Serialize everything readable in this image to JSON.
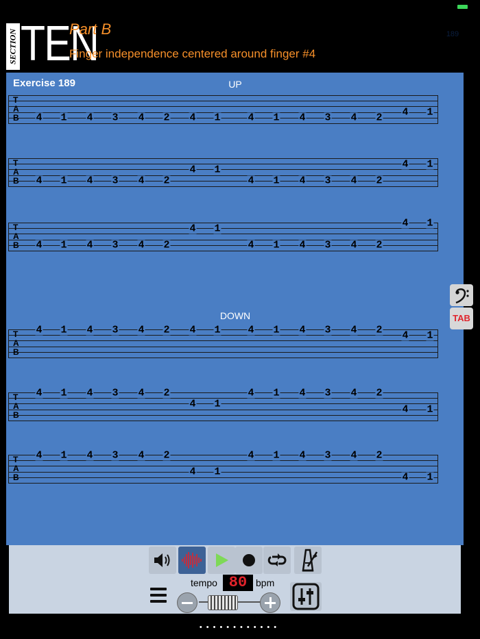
{
  "status": {
    "page_number": "189"
  },
  "header": {
    "section_word": "SECTION",
    "section_number": "TEN",
    "part_title": "Part B",
    "subtitle": "Finger independence centered around finger #4"
  },
  "exercise": {
    "title": "Exercise 189",
    "up_label": "UP",
    "down_label": "DOWN",
    "tab_letters": [
      "T",
      "A",
      "B"
    ],
    "staves": [
      {
        "frets": [
          {
            "s": 4,
            "v": "4"
          },
          {
            "s": 4,
            "v": "1"
          },
          {
            "s": 4,
            "v": "4"
          },
          {
            "s": 4,
            "v": "3"
          },
          {
            "s": 4,
            "v": "4"
          },
          {
            "s": 4,
            "v": "2"
          },
          {
            "s": 4,
            "v": "4"
          },
          {
            "s": 4,
            "v": "1"
          },
          {
            "s": 4,
            "v": "4"
          },
          {
            "s": 4,
            "v": "1"
          },
          {
            "s": 4,
            "v": "4"
          },
          {
            "s": 4,
            "v": "3"
          },
          {
            "s": 4,
            "v": "4"
          },
          {
            "s": 4,
            "v": "2"
          },
          {
            "s": 3,
            "v": "4"
          },
          {
            "s": 3,
            "v": "1"
          }
        ]
      },
      {
        "frets": [
          {
            "s": 4,
            "v": "4"
          },
          {
            "s": 4,
            "v": "1"
          },
          {
            "s": 4,
            "v": "4"
          },
          {
            "s": 4,
            "v": "3"
          },
          {
            "s": 4,
            "v": "4"
          },
          {
            "s": 4,
            "v": "2"
          },
          {
            "s": 2,
            "v": "4"
          },
          {
            "s": 2,
            "v": "1"
          },
          {
            "s": 4,
            "v": "4"
          },
          {
            "s": 4,
            "v": "1"
          },
          {
            "s": 4,
            "v": "4"
          },
          {
            "s": 4,
            "v": "3"
          },
          {
            "s": 4,
            "v": "4"
          },
          {
            "s": 4,
            "v": "2"
          },
          {
            "s": 1,
            "v": "4"
          },
          {
            "s": 1,
            "v": "1"
          }
        ]
      },
      {
        "frets": [
          {
            "s": 4,
            "v": "4"
          },
          {
            "s": 4,
            "v": "1"
          },
          {
            "s": 4,
            "v": "4"
          },
          {
            "s": 4,
            "v": "3"
          },
          {
            "s": 4,
            "v": "4"
          },
          {
            "s": 4,
            "v": "2"
          },
          {
            "s": 1,
            "v": "4"
          },
          {
            "s": 1,
            "v": "1"
          },
          {
            "s": 4,
            "v": "4"
          },
          {
            "s": 4,
            "v": "1"
          },
          {
            "s": 4,
            "v": "4"
          },
          {
            "s": 4,
            "v": "3"
          },
          {
            "s": 4,
            "v": "4"
          },
          {
            "s": 4,
            "v": "2"
          },
          {
            "s": 0,
            "v": "4"
          },
          {
            "s": 0,
            "v": "1"
          }
        ]
      },
      {
        "frets": [
          {
            "s": 0,
            "v": "4"
          },
          {
            "s": 0,
            "v": "1"
          },
          {
            "s": 0,
            "v": "4"
          },
          {
            "s": 0,
            "v": "3"
          },
          {
            "s": 0,
            "v": "4"
          },
          {
            "s": 0,
            "v": "2"
          },
          {
            "s": 0,
            "v": "4"
          },
          {
            "s": 0,
            "v": "1"
          },
          {
            "s": 0,
            "v": "4"
          },
          {
            "s": 0,
            "v": "1"
          },
          {
            "s": 0,
            "v": "4"
          },
          {
            "s": 0,
            "v": "3"
          },
          {
            "s": 0,
            "v": "4"
          },
          {
            "s": 0,
            "v": "2"
          },
          {
            "s": 1,
            "v": "4"
          },
          {
            "s": 1,
            "v": "1"
          }
        ]
      },
      {
        "frets": [
          {
            "s": 0,
            "v": "4"
          },
          {
            "s": 0,
            "v": "1"
          },
          {
            "s": 0,
            "v": "4"
          },
          {
            "s": 0,
            "v": "3"
          },
          {
            "s": 0,
            "v": "4"
          },
          {
            "s": 0,
            "v": "2"
          },
          {
            "s": 2,
            "v": "4"
          },
          {
            "s": 2,
            "v": "1"
          },
          {
            "s": 0,
            "v": "4"
          },
          {
            "s": 0,
            "v": "1"
          },
          {
            "s": 0,
            "v": "4"
          },
          {
            "s": 0,
            "v": "3"
          },
          {
            "s": 0,
            "v": "4"
          },
          {
            "s": 0,
            "v": "2"
          },
          {
            "s": 3,
            "v": "4"
          },
          {
            "s": 3,
            "v": "1"
          }
        ]
      },
      {
        "frets": [
          {
            "s": 0,
            "v": "4"
          },
          {
            "s": 0,
            "v": "1"
          },
          {
            "s": 0,
            "v": "4"
          },
          {
            "s": 0,
            "v": "3"
          },
          {
            "s": 0,
            "v": "4"
          },
          {
            "s": 0,
            "v": "2"
          },
          {
            "s": 3,
            "v": "4"
          },
          {
            "s": 3,
            "v": "1"
          },
          {
            "s": 0,
            "v": "4"
          },
          {
            "s": 0,
            "v": "1"
          },
          {
            "s": 0,
            "v": "4"
          },
          {
            "s": 0,
            "v": "3"
          },
          {
            "s": 0,
            "v": "4"
          },
          {
            "s": 0,
            "v": "2"
          },
          {
            "s": 4,
            "v": "4"
          },
          {
            "s": 4,
            "v": "1"
          }
        ]
      }
    ]
  },
  "sidebar": {
    "bass_clef_icon": "bass-clef-icon",
    "tab_label": "TAB"
  },
  "toolbar": {
    "icons": [
      "speaker-icon",
      "waveform-icon",
      "play-icon",
      "record-icon",
      "loop-icon",
      "metronome-icon",
      "menu-icon",
      "mixer-icon"
    ],
    "tempo_label": "tempo",
    "tempo_value": "80",
    "bpm_label": "bpm",
    "page_dots": "••••••••••••"
  },
  "colors": {
    "accent": "#f7902a",
    "sheet": "#4a7ec4",
    "play": "#7ed957",
    "tempo_digits": "#e2232b",
    "active": "#3d6296"
  }
}
